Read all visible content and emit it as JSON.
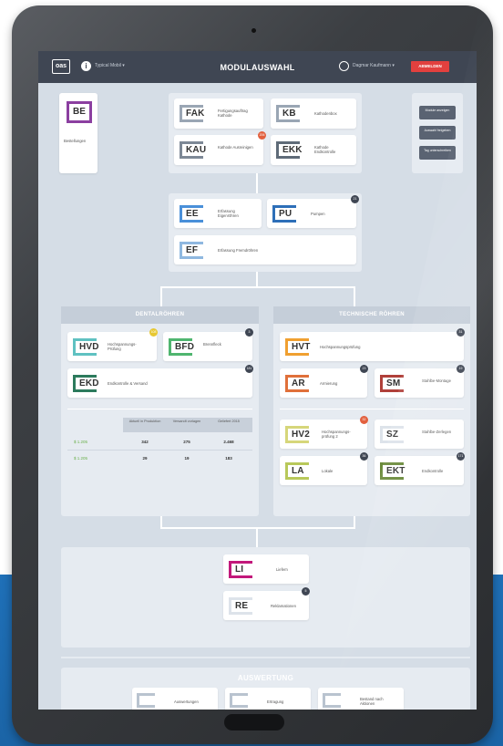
{
  "header": {
    "logo": "oas",
    "practice": "Typical Mobil ▾",
    "title": "MODULAUSWAHL",
    "user": "Dagmar Kaufmann ▾",
    "logout": "ABMELDEN"
  },
  "be": {
    "code": "BE",
    "label": "Bestellungen"
  },
  "top_modules": [
    {
      "code": "FAK",
      "label": "Fertigungsauftrag Kathode",
      "color": "#9aa6b4"
    },
    {
      "code": "KB",
      "label": "Kathodenbox",
      "color": "#9aa6b4"
    },
    {
      "code": "KAU",
      "label": "Kathode Ausreinigen",
      "color": "#7d8896",
      "badge": "206"
    },
    {
      "code": "EKK",
      "label": "Kathode Endkontrolle",
      "color": "#5f6b78"
    }
  ],
  "side_buttons": [
    "Module anzeigen",
    "Auswahl freigeben",
    "Tag unterschreiben"
  ],
  "mid_modules": [
    {
      "code": "EE",
      "label": "Erfassung Eigenröhren",
      "color": "#4a90d9"
    },
    {
      "code": "PU",
      "label": "Pumpen",
      "color": "#2d6fb8",
      "badge": "21"
    },
    {
      "code": "EF",
      "label": "Erfassung Fremdröhren",
      "color": "#8fb8e0"
    }
  ],
  "dental": {
    "title": "DENTALRÖHREN",
    "modules": [
      {
        "code": "HVD",
        "label": "Hochspannungs-Prüfung",
        "color": "#5fc1c1",
        "badge": "108"
      },
      {
        "code": "BFD",
        "label": "Brennfleck",
        "color": "#4fb56f",
        "badge": "3"
      },
      {
        "code": "EKD",
        "label": "Endkontrolle & Versand",
        "color": "#2c7a5c",
        "badge": "181"
      }
    ],
    "table": {
      "headers": [
        "Aktuell in Produktion",
        "Versandt vorlagen",
        "Geliefert 2015"
      ],
      "rows": [
        {
          "label": "$ 1.205",
          "values": [
            "342",
            "275",
            "2.468"
          ]
        },
        {
          "label": "$ 1.205",
          "values": [
            "29",
            "19",
            "183"
          ]
        }
      ]
    }
  },
  "technical": {
    "title": "TECHNISCHE RÖHREN",
    "modules": [
      {
        "code": "HVT",
        "label": "Hochspannungsprüfung",
        "color": "#f0a030",
        "badge": "31"
      },
      {
        "code": "AR",
        "label": "Armierung",
        "color": "#e0703a",
        "badge": "23"
      },
      {
        "code": "SM",
        "label": "Stahlbe-Montage",
        "color": "#b0403a",
        "badge": "19"
      },
      {
        "code": "HV2",
        "label": "Hochspannungs-prüfung 2",
        "color": "#d6d67a",
        "badge": "32"
      },
      {
        "code": "SZ",
        "label": "Stahlbe-Zerlegen",
        "color": "#dde3ea"
      },
      {
        "code": "LA",
        "label": "Lokale",
        "color": "#b8c85a",
        "badge": "36"
      },
      {
        "code": "EKT",
        "label": "Endkontrolle",
        "color": "#6a8a3a",
        "badge": "171"
      }
    ]
  },
  "bottom_modules": [
    {
      "code": "LI",
      "label": "Liefern",
      "color": "#c2187b"
    },
    {
      "code": "RE",
      "label": "Reklamationen",
      "color": "#dde3ea",
      "badge": "5"
    }
  ],
  "evaluation": {
    "title": "AUSWERTUNG",
    "items": [
      "Auswertungen",
      "Ertragung",
      "Bestand nach Aktionen"
    ]
  }
}
